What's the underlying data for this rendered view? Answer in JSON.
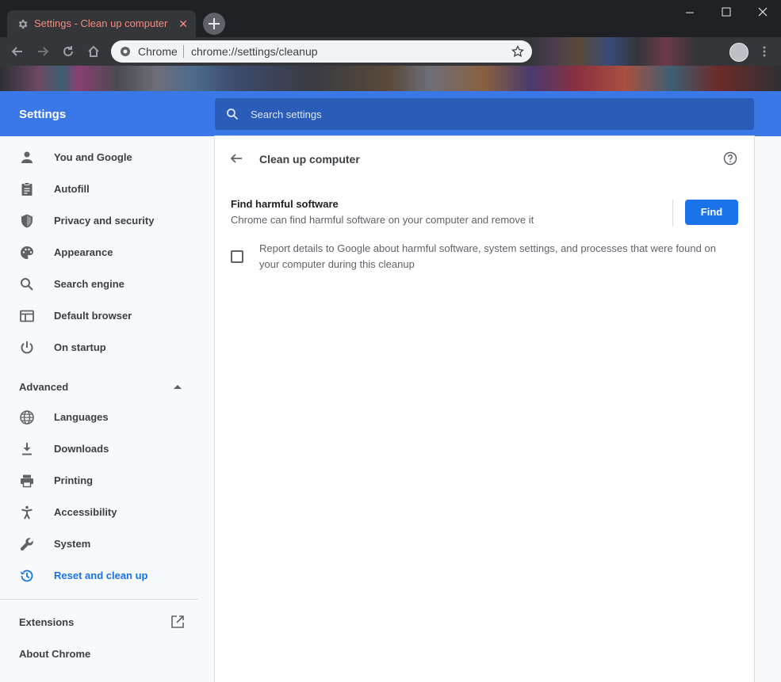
{
  "browser": {
    "tab_title": "Settings - Clean up computer",
    "omnibox_site": "Chrome",
    "omnibox_url": "chrome://settings/cleanup"
  },
  "header": {
    "title": "Settings",
    "search_placeholder": "Search settings"
  },
  "sidebar": {
    "items": [
      {
        "label": "You and Google",
        "icon": "person-icon"
      },
      {
        "label": "Autofill",
        "icon": "clipboard-icon"
      },
      {
        "label": "Privacy and security",
        "icon": "shield-icon"
      },
      {
        "label": "Appearance",
        "icon": "palette-icon"
      },
      {
        "label": "Search engine",
        "icon": "search-icon"
      },
      {
        "label": "Default browser",
        "icon": "browser-window-icon"
      },
      {
        "label": "On startup",
        "icon": "power-icon"
      }
    ],
    "advanced_label": "Advanced",
    "advanced_items": [
      {
        "label": "Languages",
        "icon": "globe-icon"
      },
      {
        "label": "Downloads",
        "icon": "download-icon"
      },
      {
        "label": "Printing",
        "icon": "printer-icon"
      },
      {
        "label": "Accessibility",
        "icon": "accessibility-icon"
      },
      {
        "label": "System",
        "icon": "wrench-icon"
      },
      {
        "label": "Reset and clean up",
        "icon": "history-icon",
        "active": true
      }
    ],
    "extensions_label": "Extensions",
    "about_label": "About Chrome"
  },
  "main": {
    "page_title": "Clean up computer",
    "find_title": "Find harmful software",
    "find_description": "Chrome can find harmful software on your computer and remove it",
    "find_button": "Find",
    "report_checkbox_checked": false,
    "report_text": "Report details to Google about harmful software, system settings, and processes that were found on your computer during this cleanup"
  },
  "colors": {
    "accent": "#1a73e8",
    "header_bg": "#3b78e7",
    "tab_title": "#f28b82"
  }
}
